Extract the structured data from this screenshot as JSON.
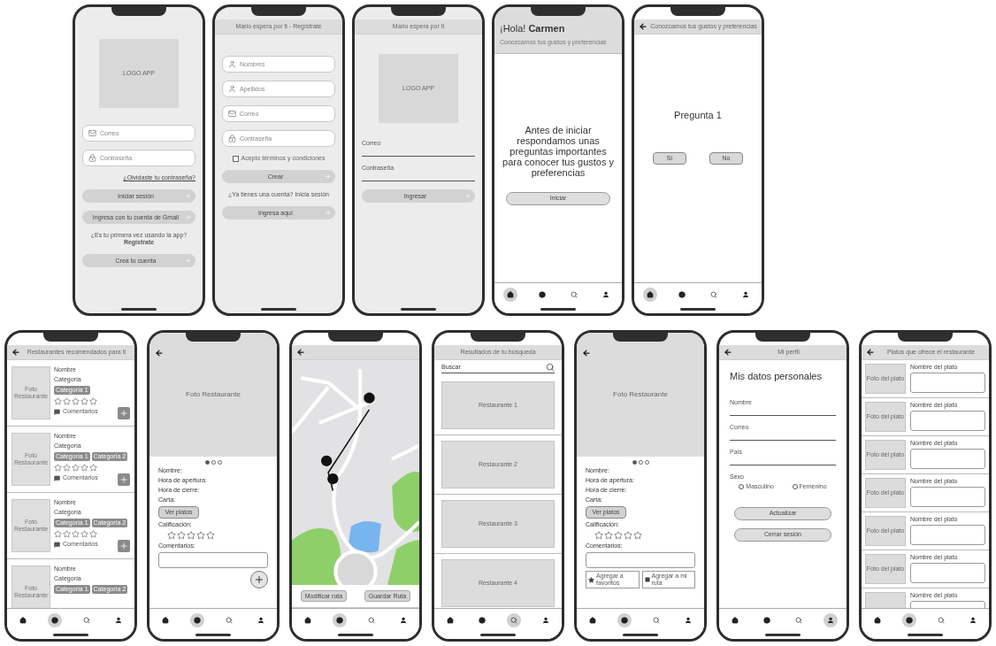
{
  "screens": [
    {
      "kind": "login",
      "body": [
        {
          "kind": "logo",
          "text": "LOGO APP"
        },
        {
          "kind": "email-field",
          "placeholder": "Correo"
        },
        {
          "kind": "password-field",
          "placeholder": "Contraseña"
        },
        {
          "kind": "link",
          "text": "¿Olvidaste tu contraseña?"
        },
        {
          "kind": "button",
          "label": "Iniciar sesión"
        },
        {
          "kind": "button",
          "label": "Ingresa con tu cuenta de Gmail"
        },
        {
          "kind": "text",
          "text": "¿Es tu primera vez usando la app? **Regístrate**"
        },
        {
          "kind": "button",
          "label": "Crea tu cuenta"
        }
      ]
    },
    {
      "kind": "register",
      "header": {
        "title": "Mario espera por ti - Regístrate"
      },
      "body": [
        {
          "kind": "name-field",
          "placeholder": "Nombres"
        },
        {
          "kind": "name-field",
          "placeholder": "Apellidos"
        },
        {
          "kind": "email-field",
          "placeholder": "Correo"
        },
        {
          "kind": "password-field",
          "placeholder": "Contraseña"
        },
        {
          "kind": "checkbox",
          "label": "Acepto términos y condiciones",
          "checked": false
        },
        {
          "kind": "button",
          "label": "Crear"
        },
        {
          "kind": "text",
          "text": "¿Ya tienes una cuenta? Inicia sesión"
        },
        {
          "kind": "button",
          "label": "Ingresa aquí"
        }
      ]
    },
    {
      "kind": "login",
      "header": {
        "title": "Mario espera por ti"
      },
      "body": [
        {
          "kind": "logo",
          "text": "LOGO APP"
        },
        {
          "kind": "line-field",
          "label": "Correo"
        },
        {
          "kind": "line-field",
          "label": "Contraseña"
        },
        {
          "kind": "button",
          "label": "Ingresar"
        }
      ]
    },
    {
      "kind": "message",
      "header": {
        "greeting": "¡Hola! **Carmen**",
        "subtitle": "Conozcamos tus gustos y preferencias"
      },
      "body": [
        {
          "kind": "message",
          "text": "Antes de iniciar respondamos unas preguntas importantes para conocer tus gustos y preferencias"
        },
        {
          "kind": "outline-button",
          "label": "Iniciar"
        }
      ],
      "nav": [
        {
          "kind": "home",
          "selected": true
        },
        {
          "kind": "explore",
          "selected": false
        },
        {
          "kind": "search",
          "selected": false
        },
        {
          "kind": "profile",
          "selected": false
        }
      ]
    },
    {
      "kind": "question",
      "header": {
        "back": true,
        "title": "Conozcamos tus gustos y preferencias"
      },
      "body": [
        {
          "kind": "message",
          "text": "Pregunta 1"
        },
        {
          "kind": "choice-row",
          "buttons": [
            {
              "label": "Sí"
            },
            {
              "label": "No"
            }
          ]
        }
      ],
      "nav": [
        {
          "kind": "home",
          "selected": true
        },
        {
          "kind": "explore",
          "selected": false
        },
        {
          "kind": "search",
          "selected": false
        },
        {
          "kind": "profile",
          "selected": false
        }
      ]
    },
    {
      "kind": "list",
      "header": {
        "back": true,
        "title": "Restaurantes recomendados para ti"
      },
      "body": [
        {
          "kind": "restaurant-card",
          "photo": "Foto Restaurante",
          "name": "Nombre",
          "category": "Categoría",
          "tags": [
            "Categoría 1"
          ],
          "stars": 0,
          "comments": "Comentarios",
          "addable": true
        },
        {
          "kind": "restaurant-card",
          "photo": "Foto Restaurante",
          "name": "Nombre",
          "category": "Categoría",
          "tags": [
            "Categoría 1",
            "Categoría 2"
          ],
          "stars": 0,
          "comments": "Comentarios",
          "addable": true
        },
        {
          "kind": "restaurant-card",
          "photo": "Foto Restaurante",
          "name": "Nombre",
          "category": "Categoría",
          "tags": [
            "Categoría 1",
            "Categoría 2"
          ],
          "stars": 0,
          "comments": "Comentarios",
          "addable": true
        },
        {
          "kind": "restaurant-card",
          "photo": "Foto Restaurante",
          "name": "Nombre",
          "category": "Categoría",
          "tags": [
            "Categoría 1",
            "Categoría 2"
          ]
        }
      ],
      "nav": [
        {
          "kind": "home",
          "selected": false
        },
        {
          "kind": "explore",
          "selected": true
        },
        {
          "kind": "search",
          "selected": false
        },
        {
          "kind": "profile",
          "selected": false
        }
      ]
    },
    {
      "kind": "detail",
      "hero": {
        "back": true,
        "label": "Foto Restaurante"
      },
      "body": [
        {
          "kind": "dots",
          "dots": [
            {
              "selected": true
            },
            {
              "selected": false
            },
            {
              "selected": false
            }
          ]
        },
        {
          "kind": "label",
          "text": "Nombre:"
        },
        {
          "kind": "label",
          "text": "Hora de apertura:"
        },
        {
          "kind": "label",
          "text": "Hora de cierre:"
        },
        {
          "kind": "label",
          "text": "Carta:"
        },
        {
          "kind": "small-button",
          "label": "Ver platos"
        },
        {
          "kind": "label",
          "text": "Calificación:"
        },
        {
          "kind": "stars",
          "stars": 0
        },
        {
          "kind": "label",
          "text": "Comentarios:"
        },
        {
          "kind": "textarea"
        },
        {
          "kind": "fab"
        }
      ],
      "nav": [
        {
          "kind": "home",
          "selected": false
        },
        {
          "kind": "explore",
          "selected": true
        },
        {
          "kind": "search",
          "selected": false
        },
        {
          "kind": "profile",
          "selected": false
        }
      ]
    },
    {
      "kind": "map",
      "header": {
        "back": true
      },
      "body": [
        {
          "kind": "map"
        },
        {
          "kind": "button-row",
          "buttons": [
            {
              "label": "Modificar ruta"
            },
            {
              "label": "Guardar Ruta"
            }
          ]
        }
      ],
      "nav": [
        {
          "kind": "home",
          "selected": false
        },
        {
          "kind": "explore",
          "selected": true
        },
        {
          "kind": "search",
          "selected": false
        },
        {
          "kind": "profile",
          "selected": false
        }
      ]
    },
    {
      "kind": "list",
      "header": {
        "title": "Resultados de tu búsqueda"
      },
      "body": [
        {
          "kind": "search-field",
          "placeholder": "Buscar"
        },
        {
          "kind": "result-card",
          "label": "Restaurante 1"
        },
        {
          "kind": "result-card",
          "label": "Restaurante 2"
        },
        {
          "kind": "result-card",
          "label": "Restaurante 3"
        },
        {
          "kind": "result-card",
          "label": "Restaurante 4"
        }
      ],
      "nav": [
        {
          "kind": "home",
          "selected": false
        },
        {
          "kind": "explore",
          "selected": false
        },
        {
          "kind": "search",
          "selected": true
        },
        {
          "kind": "profile",
          "selected": false
        }
      ]
    },
    {
      "kind": "detail",
      "hero": {
        "back": true,
        "label": "Foto Restaurante"
      },
      "body": [
        {
          "kind": "dots",
          "dots": [
            {
              "selected": true
            },
            {
              "selected": false
            },
            {
              "selected": false
            }
          ]
        },
        {
          "kind": "label",
          "text": "Nombre:"
        },
        {
          "kind": "label",
          "text": "Hora de apertura:"
        },
        {
          "kind": "label",
          "text": "Hora de cierre:"
        },
        {
          "kind": "label",
          "text": "Carta:"
        },
        {
          "kind": "small-button",
          "label": "Ver platos"
        },
        {
          "kind": "label",
          "text": "Calificación:"
        },
        {
          "kind": "stars",
          "stars": 0
        },
        {
          "kind": "label",
          "text": "Comentarios:"
        },
        {
          "kind": "textarea"
        },
        {
          "kind": "action-row",
          "buttons": [
            {
              "kind": "favorite",
              "label": "Agregar a favoritos"
            },
            {
              "kind": "route",
              "label": "Agregar a mi ruta"
            }
          ]
        }
      ],
      "nav": [
        {
          "kind": "home",
          "selected": false
        },
        {
          "kind": "explore",
          "selected": true
        },
        {
          "kind": "search",
          "selected": false
        },
        {
          "kind": "profile",
          "selected": false
        }
      ]
    },
    {
      "kind": "profile",
      "header": {
        "back": true,
        "title": "Mi perfil"
      },
      "body": [
        {
          "kind": "heading",
          "text": "Mis datos personales"
        },
        {
          "kind": "line-field",
          "label": "Nombre"
        },
        {
          "kind": "line-field",
          "label": "Correo"
        },
        {
          "kind": "line-field",
          "label": "País"
        },
        {
          "kind": "radio-group",
          "label": "Sexo",
          "options": [
            {
              "label": "Masculino",
              "selected": false
            },
            {
              "label": "Femenino",
              "selected": false
            }
          ]
        },
        {
          "kind": "outline-button",
          "label": "Actualizar"
        },
        {
          "kind": "outline-button",
          "label": "Cerrar sesión"
        }
      ],
      "nav": [
        {
          "kind": "home",
          "selected": false
        },
        {
          "kind": "explore",
          "selected": false
        },
        {
          "kind": "search",
          "selected": false
        },
        {
          "kind": "profile",
          "selected": true
        }
      ]
    },
    {
      "kind": "list",
      "header": {
        "back": true,
        "title": "Platos que ofrece el restaurante"
      },
      "body": [
        {
          "kind": "dish-row",
          "photo": "Foto del plato",
          "name": "Nombre del plato"
        },
        {
          "kind": "dish-row",
          "photo": "Foto del plato",
          "name": "Nombre del plato"
        },
        {
          "kind": "dish-row",
          "photo": "Foto del plato",
          "name": "Nombre del plato"
        },
        {
          "kind": "dish-row",
          "photo": "Foto del plato",
          "name": "Nombre del plato"
        },
        {
          "kind": "dish-row",
          "photo": "Foto del plato",
          "name": "Nombre del plato"
        },
        {
          "kind": "dish-row",
          "photo": "Foto del plato",
          "name": "Nombre del plato"
        },
        {
          "kind": "dish-row",
          "name": "Nombre del plato"
        }
      ],
      "nav": [
        {
          "kind": "home",
          "selected": false
        },
        {
          "kind": "explore",
          "selected": true
        },
        {
          "kind": "search",
          "selected": false
        },
        {
          "kind": "profile",
          "selected": false
        }
      ]
    }
  ]
}
